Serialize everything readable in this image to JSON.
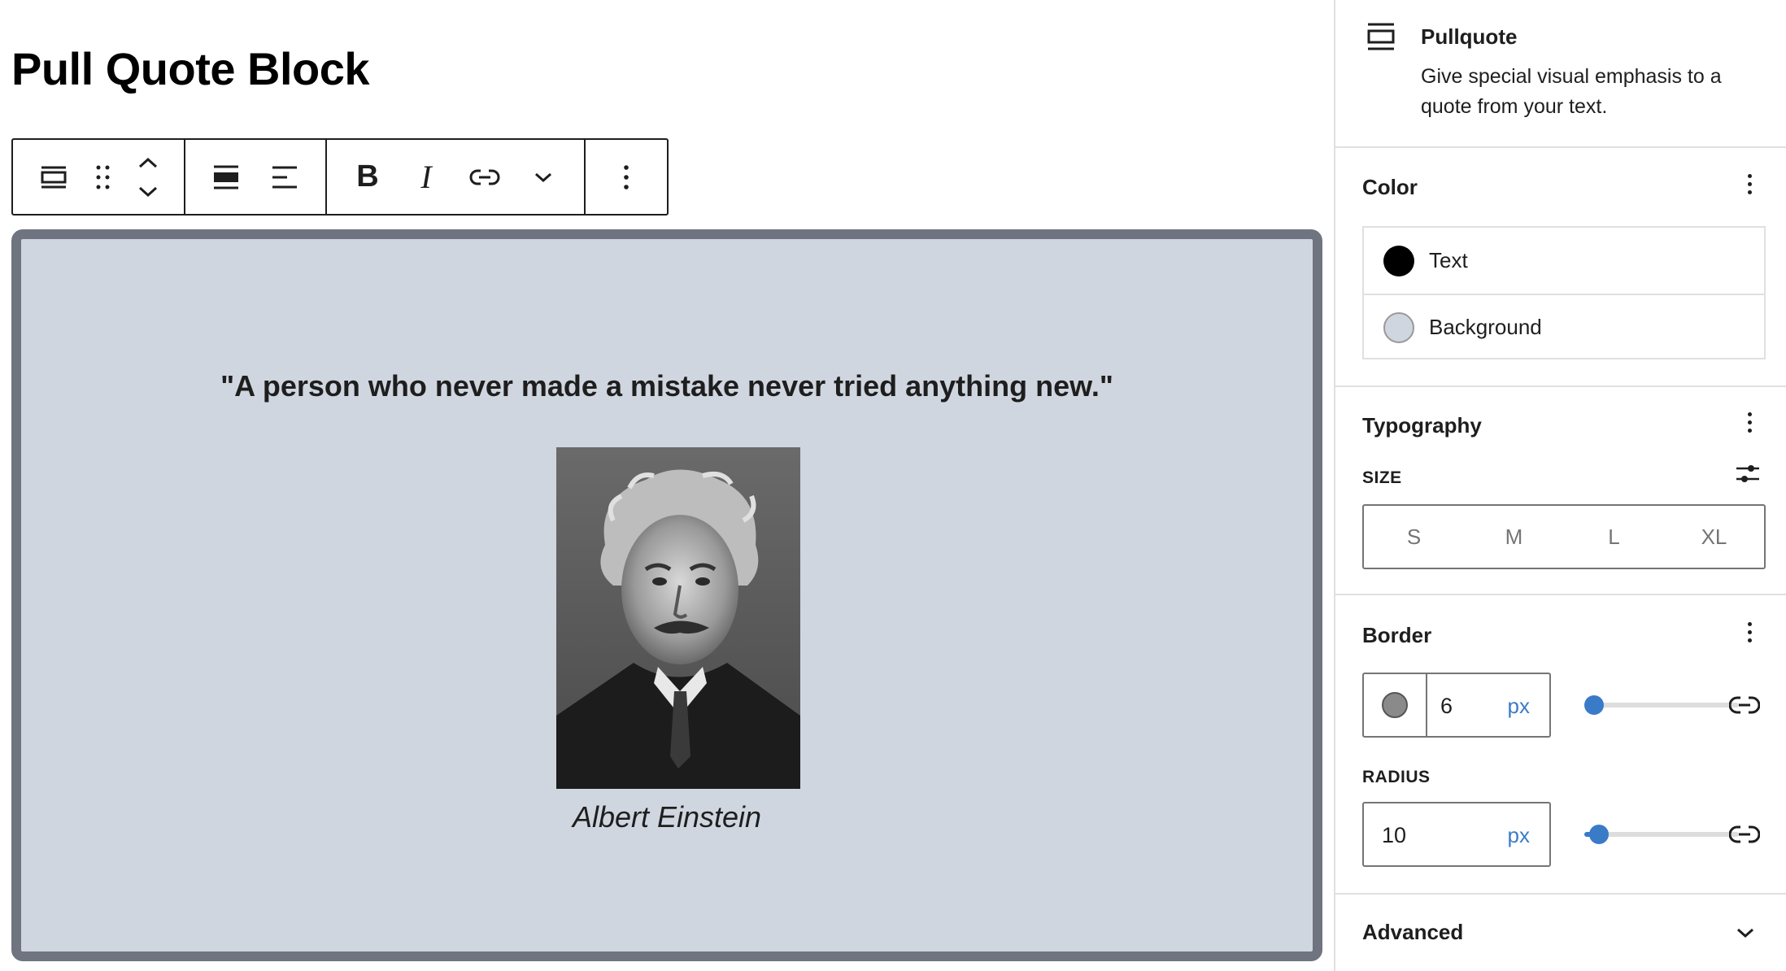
{
  "editor": {
    "title": "Pull Quote Block",
    "toolbar": {
      "more_label": "⋮"
    },
    "pullquote": {
      "quote": "\"A person who never made a mistake never tried anything new.\"",
      "citation": "Albert Einstein",
      "image_icon": "einstein-portrait",
      "background_color": "#d0d6e0",
      "border_color": "#6f7480"
    }
  },
  "sidebar": {
    "block_card": {
      "title": "Pullquote",
      "description": "Give special visual emphasis to a quote from your text."
    },
    "color": {
      "title": "Color",
      "items": [
        {
          "label": "Text",
          "swatch": "#000000"
        },
        {
          "label": "Background",
          "swatch": "#d0d6e0"
        }
      ]
    },
    "typography": {
      "title": "Typography",
      "size_label": "SIZE",
      "sizes": [
        "S",
        "M",
        "L",
        "XL"
      ]
    },
    "border": {
      "title": "Border",
      "width_value": "6",
      "width_unit": "px",
      "color_swatch": "#8a8a8a",
      "radius_label": "RADIUS",
      "radius_value": "10",
      "radius_unit": "px"
    },
    "advanced": {
      "title": "Advanced"
    }
  },
  "colors": {
    "accent": "#3a7bc8",
    "border_light": "#e0e0e0"
  }
}
